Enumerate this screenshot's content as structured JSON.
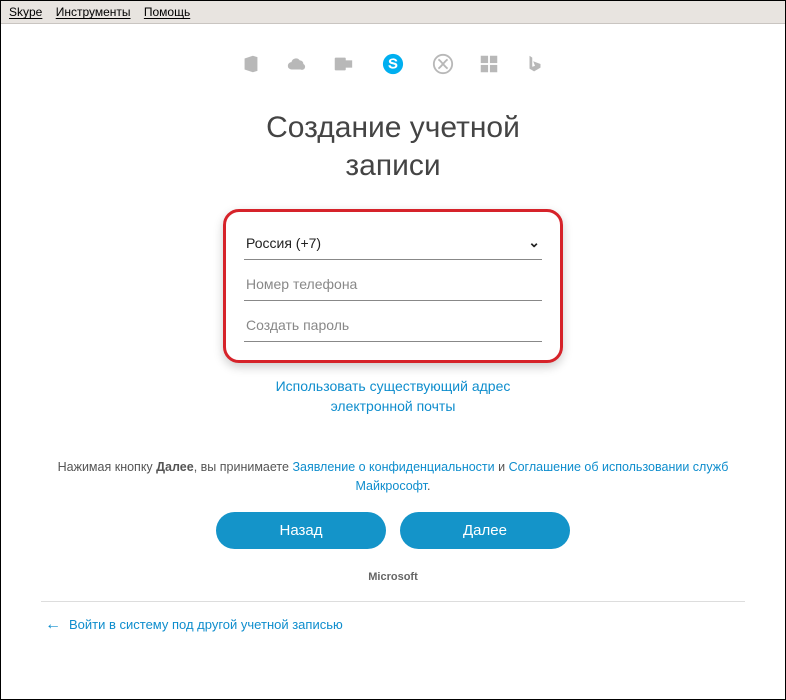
{
  "menu": {
    "skype": "Skype",
    "tools": "Инструменты",
    "help": "Помощь"
  },
  "heading_line1": "Создание учетной",
  "heading_line2": "записи",
  "form": {
    "country": "Россия (+7)",
    "phone_placeholder": "Номер телефона",
    "password_placeholder": "Создать пароль"
  },
  "use_email_link_line1": "Использовать существующий адрес",
  "use_email_link_line2": "электронной почты",
  "terms": {
    "prefix": "Нажимая кнопку ",
    "next_word": "Далее",
    "mid": ", вы принимаете ",
    "privacy": "Заявление о конфиденциальности",
    "and": " и ",
    "agreement": "Соглашение об использовании служб Майкрософт",
    "suffix": "."
  },
  "buttons": {
    "back": "Назад",
    "next": "Далее"
  },
  "brand": "Microsoft",
  "footer_link": "Войти в систему под другой учетной записью"
}
